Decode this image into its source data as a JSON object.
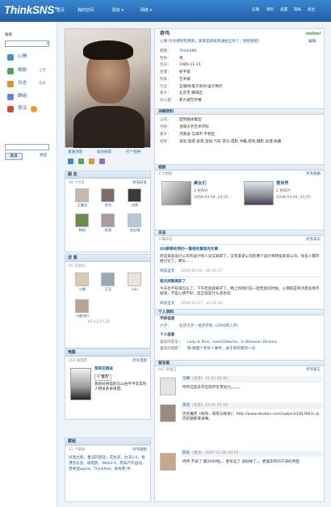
{
  "header": {
    "logo": "ThinkSNS",
    "logo_mark": "TM",
    "nav": [
      "首页",
      "我的空间",
      "朋友",
      "网络"
    ],
    "nav_dropdown": [
      "▾",
      "▾"
    ],
    "top_links": [
      "信箱",
      "资料",
      "设置",
      "隐私",
      "退出"
    ]
  },
  "sidebar": {
    "search_label": "搜索",
    "items": [
      {
        "label": "心情",
        "icon": "mood-icon"
      },
      {
        "label": "相册",
        "extra": "上传",
        "icon": "album-icon"
      },
      {
        "label": "日志",
        "extra": "发表",
        "icon": "blog-icon"
      },
      {
        "label": "群组",
        "icon": "group-icon"
      },
      {
        "label": "意见",
        "icon": "feedback-icon"
      }
    ],
    "invite_button": "邀请",
    "preview_link": "预览"
  },
  "profile": {
    "name": "奇鸟",
    "online": "online!",
    "mood_prefix": "心情：",
    "mood": "今天把时刻更新，某某是新组到通径正呼了；哈哈哈哈！",
    "mood_edit": "编辑",
    "actions": [
      "发送消息",
      "加为好友",
      "打个招呼"
    ],
    "basic": [
      {
        "k": "网络：",
        "v": "ThinkSNS",
        "link": true
      },
      {
        "k": "性别：",
        "v": "男"
      },
      {
        "k": "生日：",
        "v": "1985-11-15"
      },
      {
        "k": "星座：",
        "v": "射手座"
      },
      {
        "k": "院系：",
        "v": "艺术类"
      },
      {
        "k": "行业：",
        "v": "互联网/电子商务/设计制作"
      },
      {
        "k": "家乡：",
        "v": "北京市 朝阳区"
      },
      {
        "k": "办公室：",
        "v": "新力城写字楼"
      }
    ],
    "detail_title": "详细资料",
    "detail": [
      {
        "k": "公司：",
        "v": "趋势媒体集团"
      },
      {
        "k": "学校：",
        "v": "洛阳大学艺术学院"
      },
      {
        "k": "家乡：",
        "v": "河南省 信阳市 平桥区"
      },
      {
        "k": "爱好：",
        "v": "美食,旅游,投资,运动,汽车,音乐,电影,书籍,游戏,摄影,动漫,收藏"
      }
    ]
  },
  "friends": {
    "title": "朋 友",
    "count": "18 个好友",
    "all": "所有好友",
    "items": [
      "王春龙",
      "奇鸟",
      "刘燕",
      "韩倪",
      "陈荣",
      "金红梅"
    ]
  },
  "visitors": {
    "title": "访 客",
    "count": "65 次访问",
    "items": [
      "小鹤",
      "王豆",
      "lulu",
      "小鹤(转)",
      "01-13 17:24"
    ],
    "time": "01-13 17:24"
  },
  "movie": {
    "title": "电影",
    "count": "253 部电影",
    "all": "所有电影",
    "name": "茉莉花跳进",
    "tag": "+ 推荐",
    "desc": "我很好奇电影怎么拍平平常常的人物关系讲清楚。"
  },
  "groups": {
    "title": "群组",
    "count": "11 个群组",
    "all": "所有群组",
    "text": "好酒之境，鲁迅的旅途，花生买，台湾2.0，香港音乐会，碰电影，Web2.0，周末户外运动，苹果迷apple，ThinkPad，单身吧·书"
  },
  "albums": {
    "title": "相册",
    "count": "2 个相册",
    "all": "所有相册",
    "items": [
      {
        "name": "美女们",
        "meta": "2 张照片",
        "date": "2008-04-04 ,23:55"
      },
      {
        "name": "雪世界",
        "meta": "2 张照片",
        "date": "2008-04-04 ,23:55"
      }
    ]
  },
  "blog": {
    "title": "日志",
    "count": "3 篇日志",
    "all": "所有日志",
    "posts": [
      {
        "title": "QQ群聊收到的一篇很有意思的文章",
        "body": "听说某某设计公司的设计师人员又离职了，又有某某公司的两个设计师转投某某公司，很多人都开始讨论了。那么……",
        "more": "阅读全文",
        "date": "2008-04-05 , 00:45:17"
      },
      {
        "title": "暗兵网管离职了",
        "body": "今天也不知道怎么了，下午吃饭就离开了，晚上和他们在一起吃饭的时候，心情就是有点莫名地不愉快，不是心情不好，反正就是什么话也说",
        "more": "阅读全文",
        "date": "2008-03-17 , 23:32:20"
      }
    ]
  },
  "personal": {
    "title": "个人资料",
    "edu_title": "学校信息",
    "edu": {
      "k": "大学：",
      "v": "北京大学 - 经济学院（2000年入学）"
    },
    "info_title": "个人信息",
    "music": {
      "k": "喜欢的音乐：",
      "v": "Lady & Bird，Getz/Gilberto，In Between Dreams"
    },
    "movie": {
      "k": "喜欢的电影：",
      "v": "杨·德雷少年杀人事件，关于莉莉周的一切"
    }
  },
  "guestbook": {
    "title": "留言板",
    "count": "647 条留言",
    "all": "所有留言",
    "entries": [
      {
        "user": "马赛",
        "loc": "(北京)",
        "date": "12-31 01:43",
        "text": "呵呵这是去年在阳学生劳动力。。。。。"
      },
      {
        "user": "李亮",
        "loc": "(北京)",
        "date": "12-31 01:43",
        "text": "历史推荐《祝你，病愈与秘诀》：http://www.douban.com/subject/1813841/ 从历史翻练来讲事。"
      },
      {
        "user": "陈松",
        "loc": "(湖北)",
        "date": "2007-12-26 20:03",
        "text": "呵呵 不早了 都2000啦。。更毕业了 该好样了。。更喜欢有内干净的界面"
      }
    ]
  }
}
